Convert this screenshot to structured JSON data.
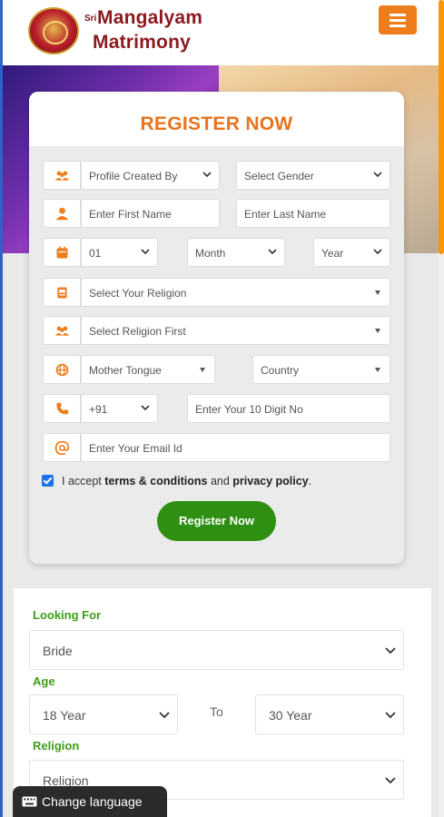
{
  "header": {
    "logo_small": "Sri",
    "logo_line1": "Mangalyam",
    "logo_line2": "Matrimony",
    "menu_icon": "hamburger-icon",
    "accent": "#ee7d1c",
    "brand_color": "#8b1a1f"
  },
  "register": {
    "title": "REGISTER NOW",
    "profile_created_by": "Profile Created By",
    "gender": "Select Gender",
    "first_name_placeholder": "Enter First Name",
    "last_name_placeholder": "Enter Last Name",
    "day": "01",
    "month": "Month",
    "year": "Year",
    "religion": "Select Your Religion",
    "caste": "Select Religion First",
    "mother_tongue": "Mother Tongue",
    "country": "Country",
    "phone_code": "+91",
    "phone_placeholder": "Enter Your 10 Digit No",
    "email_placeholder": "Enter Your Email Id",
    "accept_prefix": "I accept ",
    "terms_link": "terms & conditions",
    "and_text": " and ",
    "privacy_link": "privacy policy",
    "period": ".",
    "accepted": true,
    "submit_label": "Register Now",
    "title_color": "#e8731c",
    "button_color": "#2f8f13"
  },
  "search": {
    "looking_for_label": "Looking For",
    "looking_for_value": "Bride",
    "age_label": "Age",
    "age_from": "18 Year",
    "age_to_label": "To",
    "age_to": "30 Year",
    "religion_label": "Religion",
    "religion_value": "Religion",
    "label_color": "#3d9d17"
  },
  "language": {
    "label": "Change language",
    "icon": "keyboard-icon"
  }
}
